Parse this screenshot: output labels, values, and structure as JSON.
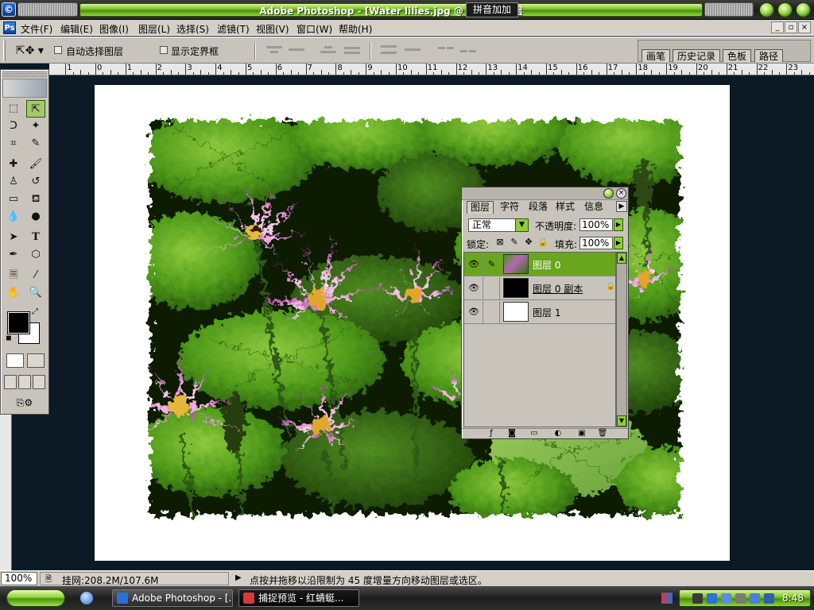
{
  "titlebar": {
    "title": "Adobe Photoshop - [Water lilies.jpg @ 100% (图层",
    "ime_label": "拼音加加"
  },
  "menubar": {
    "items": [
      "文件(F)",
      "编辑(E)",
      "图像(I)",
      "图层(L)",
      "选择(S)",
      "滤镜(T)",
      "视图(V)",
      "窗口(W)",
      "帮助(H)"
    ],
    "window_controls": [
      "_",
      "▫",
      "×"
    ]
  },
  "options": {
    "auto_select_layer": "自动选择图层",
    "show_bounding_box": "显示定界框"
  },
  "palette_well": {
    "tabs": [
      "画笔",
      "历史记录",
      "色板",
      "路径"
    ]
  },
  "rulers": {
    "h_labels": [
      "1",
      "0",
      "1",
      "2",
      "3",
      "4",
      "5",
      "6",
      "7",
      "8",
      "9",
      "10",
      "11",
      "12",
      "13",
      "14",
      "15",
      "16",
      "17",
      "18",
      "19",
      "20",
      "21",
      "22",
      "23"
    ],
    "v_labels": [
      "0",
      "1",
      "2",
      "3",
      "4",
      "5",
      "6"
    ]
  },
  "layers_panel": {
    "tabs": [
      "图层",
      "字符",
      "段落",
      "样式",
      "信息"
    ],
    "blend_mode": "正常",
    "opacity_label": "不透明度:",
    "opacity_value": "100%",
    "lock_label": "锁定:",
    "fill_label": "填充:",
    "fill_value": "100%",
    "layers": [
      {
        "name": "图层 0",
        "selected": true
      },
      {
        "name": "图层 0 副本",
        "selected": false
      },
      {
        "name": "图层 1",
        "selected": false
      }
    ]
  },
  "statusbar": {
    "zoom": "100%",
    "doc_size": "挂网:208.2M/107.6M",
    "hint": "点按并拖移以沿限制为 45 度增量方向移动图层或选区。"
  },
  "taskbar": {
    "tasks": [
      "Adobe Photoshop - [...",
      "捕捉预览 - 红蜻蜓..."
    ],
    "clock": "8:48"
  },
  "colors": {
    "accent_green": "#6aa51e",
    "document_bg": "#0b1a24",
    "chrome_gray": "#c8c4bc"
  }
}
